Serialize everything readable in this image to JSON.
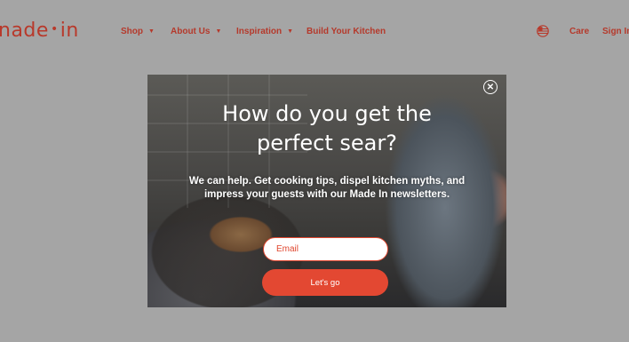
{
  "header": {
    "logo_main": "nade",
    "logo_dot": "•",
    "logo_end": "in",
    "menu": [
      {
        "label": "Shop",
        "caret": "▼"
      },
      {
        "label": "About Us",
        "caret": "▼"
      },
      {
        "label": "Inspiration",
        "caret": "▼"
      },
      {
        "label": "Build Your Kitchen"
      }
    ],
    "care": "Care",
    "sign_in": "Sign In"
  },
  "modal": {
    "close": "✕",
    "headline_1": "How do you get the",
    "headline_2": "perfect sear?",
    "subtext_1": "We can help. Get cooking tips, dispel kitchen myths, and",
    "subtext_2": "impress your guests with our Made In newsletters.",
    "email_placeholder": "Email",
    "cta": "Let's go"
  },
  "colors": {
    "brand": "#b8392b",
    "cta": "#e34832",
    "overlay": "#a5a5a5"
  }
}
